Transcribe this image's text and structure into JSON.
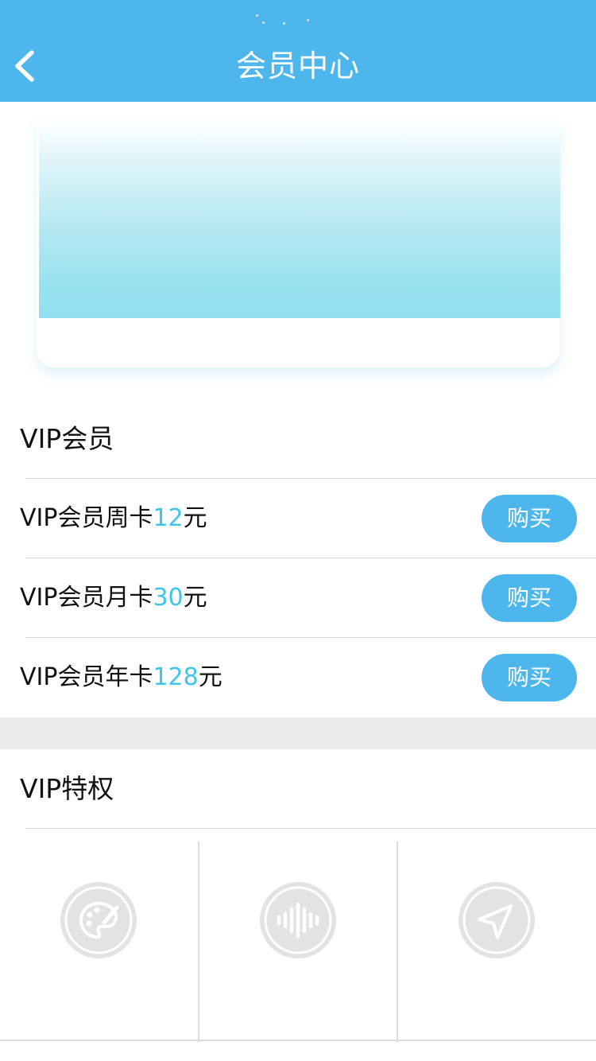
{
  "header": {
    "title": "会员中心",
    "background_color": "#4db6ec"
  },
  "vip_section": {
    "title": "VIP会员",
    "plans": [
      {
        "prefix": "VIP会员周卡",
        "price": "12",
        "unit": "元",
        "buy_label": "购买"
      },
      {
        "prefix": "VIP会员月卡",
        "price": "30",
        "unit": "元",
        "buy_label": "购买"
      },
      {
        "prefix": "VIP会员年卡",
        "price": "128",
        "unit": "元",
        "buy_label": "购买"
      }
    ]
  },
  "privileges_section": {
    "title": "VIP特权",
    "icons": [
      "palette-icon",
      "audio-wave-icon",
      "navigation-arrow-icon"
    ]
  },
  "colors": {
    "accent": "#4db6ec",
    "price": "#3ec6ea",
    "separator_band": "#ebebeb"
  }
}
